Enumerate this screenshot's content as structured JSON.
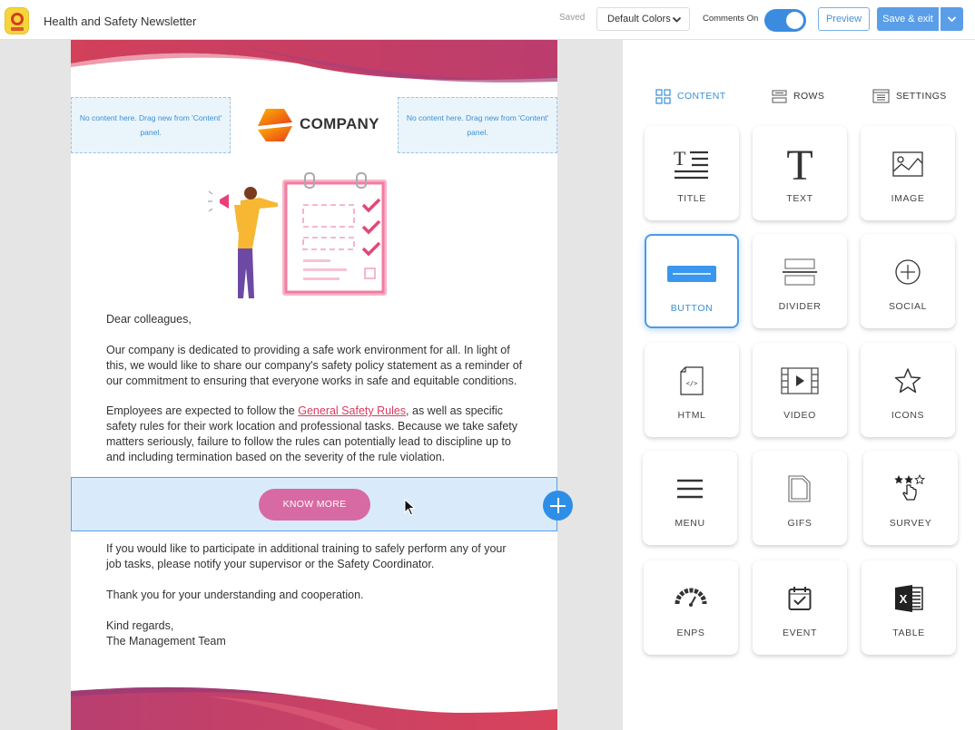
{
  "topbar": {
    "app_title": "Health and Safety Newsletter",
    "saved_status": "Saved",
    "color_scheme": "Default Colors",
    "comments_label": "Comments On",
    "comments_on": true,
    "preview_label": "Preview",
    "save_exit_label": "Save & exit"
  },
  "email": {
    "placeholder_left": "No content here. Drag new from 'Content' panel.",
    "placeholder_right": "No content here. Drag new from 'Content' panel.",
    "company_name": "COMPANY",
    "greeting": "Dear colleagues,",
    "para1": "Our company is dedicated to providing a safe work environment for all. In light of this, we would like to share our company's safety policy statement as a reminder of our commitment to ensuring that everyone works in safe and equitable conditions.",
    "para2_before": "Employees are expected to follow the ",
    "para2_link": "General Safety Rules",
    "para2_after": ", as well as specific safety rules for their work location and professional tasks. Because we take safety matters seriously, failure to follow the rules can potentially lead to discipline up to and including termination based on the severity of the rule violation.",
    "cta_button": "KNOW MORE",
    "para3": "If you would like to participate in additional training to safely perform any of your job tasks, please notify your supervisor or the Safety Coordinator.",
    "para4": "Thank you for your understanding and cooperation.",
    "closing": "Kind regards,",
    "signature": "The Management Team"
  },
  "panel": {
    "tabs": [
      {
        "label": "CONTENT",
        "icon": "grid-icon",
        "active": true
      },
      {
        "label": "ROWS",
        "icon": "rows-icon",
        "active": false
      },
      {
        "label": "SETTINGS",
        "icon": "settings-icon",
        "active": false
      }
    ],
    "blocks": [
      {
        "label": "TITLE",
        "icon": "title-icon"
      },
      {
        "label": "TEXT",
        "icon": "text-icon"
      },
      {
        "label": "IMAGE",
        "icon": "image-icon"
      },
      {
        "label": "BUTTON",
        "icon": "button-icon",
        "selected": true
      },
      {
        "label": "DIVIDER",
        "icon": "divider-icon"
      },
      {
        "label": "SOCIAL",
        "icon": "social-icon"
      },
      {
        "label": "HTML",
        "icon": "html-icon"
      },
      {
        "label": "VIDEO",
        "icon": "video-icon"
      },
      {
        "label": "ICONS",
        "icon": "star-icon"
      },
      {
        "label": "MENU",
        "icon": "menu-icon"
      },
      {
        "label": "GIFS",
        "icon": "gifs-icon"
      },
      {
        "label": "SURVEY",
        "icon": "survey-icon"
      },
      {
        "label": "ENPS",
        "icon": "gauge-icon"
      },
      {
        "label": "EVENT",
        "icon": "calendar-check-icon"
      },
      {
        "label": "TABLE",
        "icon": "spreadsheet-icon"
      }
    ]
  },
  "colors": {
    "accent": "#3a8fd5",
    "save_button": "#5a9ee8",
    "cta_button": "#d86aa3",
    "link": "#d93b5e",
    "wave": "#c83d64"
  }
}
